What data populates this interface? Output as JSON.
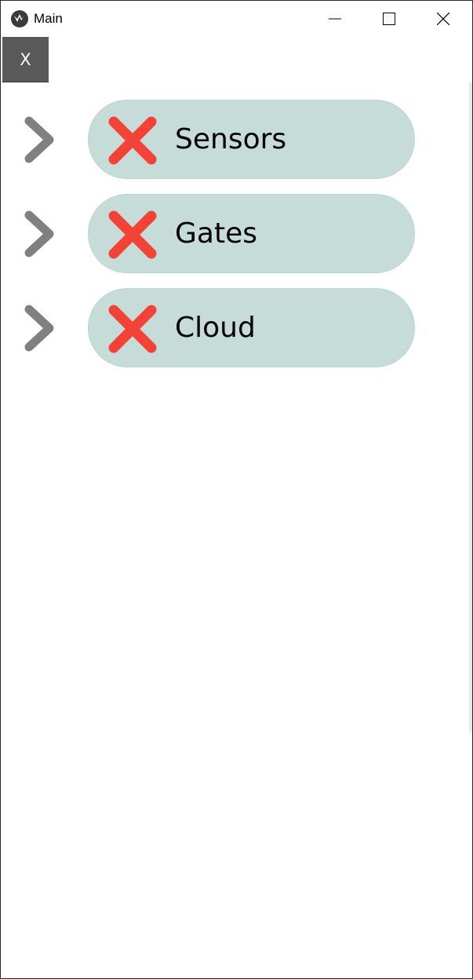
{
  "window": {
    "title": "Main"
  },
  "close_button": {
    "label": "X"
  },
  "items": [
    {
      "label": "Sensors",
      "status": "error"
    },
    {
      "label": "Gates",
      "status": "error"
    },
    {
      "label": "Cloud",
      "status": "error"
    }
  ],
  "colors": {
    "pill_bg": "#c5dcd9",
    "error_x": "#f44336",
    "chevron": "#808080",
    "close_button_bg": "#595959"
  }
}
